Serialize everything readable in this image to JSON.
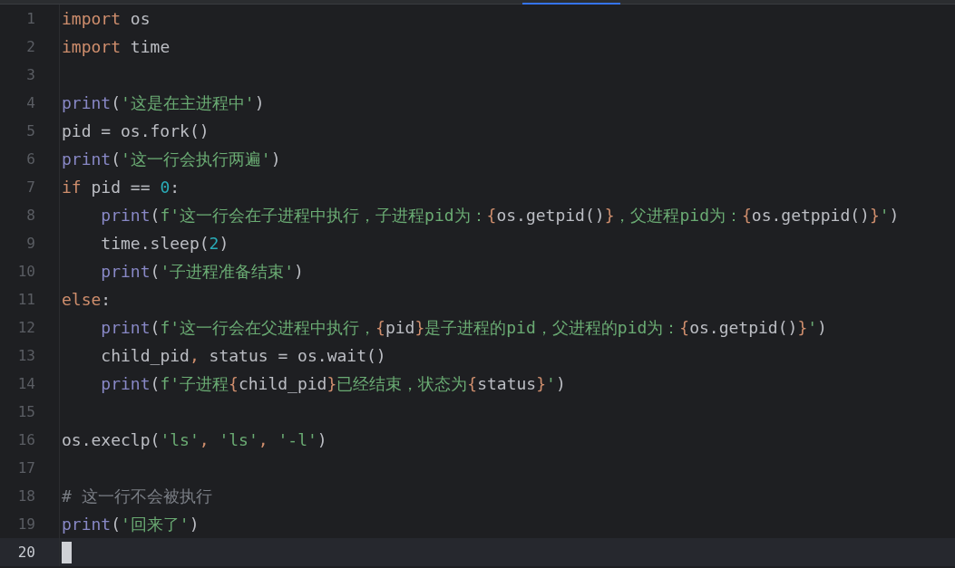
{
  "lines": [
    {
      "number": "1",
      "current": false,
      "tokens": [
        {
          "text": "import",
          "kind": "keyword"
        },
        {
          "text": " os",
          "kind": "plain"
        }
      ]
    },
    {
      "number": "2",
      "current": false,
      "tokens": [
        {
          "text": "import",
          "kind": "keyword"
        },
        {
          "text": " time",
          "kind": "plain"
        }
      ]
    },
    {
      "number": "3",
      "current": false
    },
    {
      "number": "4",
      "current": false,
      "tokens": [
        {
          "text": "print",
          "kind": "builtin"
        },
        {
          "text": "(",
          "kind": "plain"
        },
        {
          "text": "'这是在主进程中'",
          "kind": "string"
        },
        {
          "text": ")",
          "kind": "plain"
        }
      ]
    },
    {
      "number": "5",
      "current": false,
      "tokens": [
        {
          "text": "pid = os.fork()",
          "kind": "plain"
        }
      ]
    },
    {
      "number": "6",
      "current": false,
      "tokens": [
        {
          "text": "print",
          "kind": "builtin"
        },
        {
          "text": "(",
          "kind": "plain"
        },
        {
          "text": "'这一行会执行两遍'",
          "kind": "string"
        },
        {
          "text": ")",
          "kind": "plain"
        }
      ]
    },
    {
      "number": "7",
      "current": false,
      "tokens": [
        {
          "text": "if",
          "kind": "keyword"
        },
        {
          "text": " pid == ",
          "kind": "plain"
        },
        {
          "text": "0",
          "kind": "number"
        },
        {
          "text": ":",
          "kind": "plain"
        }
      ],
      "children": [
        {
          "number": "8",
          "current": false,
          "tokens": [
            {
              "text": "print",
              "kind": "builtin"
            },
            {
              "text": "(",
              "kind": "plain"
            },
            {
              "text": "f'这一行会在子进程中执行，子进程pid为：",
              "kind": "string"
            },
            {
              "text": "{",
              "kind": "keyword"
            },
            {
              "text": "os.getpid()",
              "kind": "plain"
            },
            {
              "text": "}",
              "kind": "keyword"
            },
            {
              "text": "，父进程pid为：",
              "kind": "string"
            },
            {
              "text": "{",
              "kind": "keyword"
            },
            {
              "text": "os.getppid()",
              "kind": "plain"
            },
            {
              "text": "}",
              "kind": "keyword"
            },
            {
              "text": "'",
              "kind": "string"
            },
            {
              "text": ")",
              "kind": "plain"
            }
          ]
        },
        {
          "number": "9",
          "current": false,
          "tokens": [
            {
              "text": "time.sleep(",
              "kind": "plain"
            },
            {
              "text": "2",
              "kind": "number"
            },
            {
              "text": ")",
              "kind": "plain"
            }
          ]
        },
        {
          "number": "10",
          "current": false,
          "tokens": [
            {
              "text": "print",
              "kind": "builtin"
            },
            {
              "text": "(",
              "kind": "plain"
            },
            {
              "text": "'子进程准备结束'",
              "kind": "string"
            },
            {
              "text": ")",
              "kind": "plain"
            }
          ]
        }
      ]
    },
    {
      "number": "11",
      "current": false,
      "tokens": [
        {
          "text": "else",
          "kind": "keyword"
        },
        {
          "text": ":",
          "kind": "plain"
        }
      ],
      "children": [
        {
          "number": "12",
          "current": false,
          "tokens": [
            {
              "text": "print",
              "kind": "builtin"
            },
            {
              "text": "(",
              "kind": "plain"
            },
            {
              "text": "f'这一行会在父进程中执行，",
              "kind": "string"
            },
            {
              "text": "{",
              "kind": "keyword"
            },
            {
              "text": "pid",
              "kind": "plain"
            },
            {
              "text": "}",
              "kind": "keyword"
            },
            {
              "text": "是子进程的pid，父进程的pid为：",
              "kind": "string"
            },
            {
              "text": "{",
              "kind": "keyword"
            },
            {
              "text": "os.getpid()",
              "kind": "plain"
            },
            {
              "text": "}",
              "kind": "keyword"
            },
            {
              "text": "'",
              "kind": "string"
            },
            {
              "text": ")",
              "kind": "plain"
            }
          ]
        },
        {
          "number": "13",
          "current": false,
          "tokens": [
            {
              "text": "child_pid",
              "kind": "plain"
            },
            {
              "text": ",",
              "kind": "keyword"
            },
            {
              "text": " status = os.wait()",
              "kind": "plain"
            }
          ]
        },
        {
          "number": "14",
          "current": false,
          "tokens": [
            {
              "text": "print",
              "kind": "builtin"
            },
            {
              "text": "(",
              "kind": "plain"
            },
            {
              "text": "f'子进程",
              "kind": "string"
            },
            {
              "text": "{",
              "kind": "keyword"
            },
            {
              "text": "child_pid",
              "kind": "plain"
            },
            {
              "text": "}",
              "kind": "keyword"
            },
            {
              "text": "已经结束，状态为",
              "kind": "string"
            },
            {
              "text": "{",
              "kind": "keyword"
            },
            {
              "text": "status",
              "kind": "plain"
            },
            {
              "text": "}",
              "kind": "keyword"
            },
            {
              "text": "'",
              "kind": "string"
            },
            {
              "text": ")",
              "kind": "plain"
            }
          ]
        }
      ]
    },
    {
      "number": "15",
      "current": false
    },
    {
      "number": "16",
      "current": false,
      "tokens": [
        {
          "text": "os.execlp(",
          "kind": "plain"
        },
        {
          "text": "'ls'",
          "kind": "string"
        },
        {
          "text": ", ",
          "kind": "keyword"
        },
        {
          "text": "'ls'",
          "kind": "string"
        },
        {
          "text": ", ",
          "kind": "keyword"
        },
        {
          "text": "'-l'",
          "kind": "string"
        },
        {
          "text": ")",
          "kind": "plain"
        }
      ]
    },
    {
      "number": "17",
      "current": false
    },
    {
      "number": "18",
      "current": false,
      "tokens": [
        {
          "text": "# 这一行不会被执行",
          "kind": "comment"
        }
      ]
    },
    {
      "number": "19",
      "current": false,
      "tokens": [
        {
          "text": "print",
          "kind": "builtin"
        },
        {
          "text": "(",
          "kind": "plain"
        },
        {
          "text": "'回来了'",
          "kind": "string"
        },
        {
          "text": ")",
          "kind": "plain"
        }
      ]
    },
    {
      "number": "20",
      "current": true
    }
  ]
}
